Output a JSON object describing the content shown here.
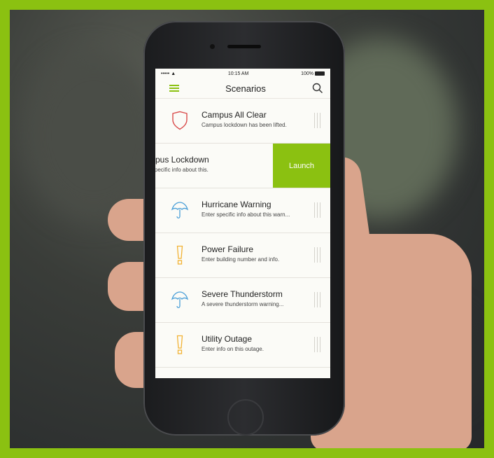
{
  "status_bar": {
    "signal": "••••• ▲",
    "time": "10:15 AM",
    "battery": "100%"
  },
  "navbar": {
    "title": "Scenarios",
    "menu_icon": "hamburger-menu-icon",
    "search_icon": "search-icon"
  },
  "scenarios": [
    {
      "title": "Campus All Clear",
      "subtitle": "Campus lockdown has been lifted.",
      "icon": "shield-icon",
      "icon_color": "#d94b4b"
    },
    {
      "title": "mpus Lockdown",
      "subtitle": "r specific info about this.",
      "swiped": true,
      "action_label": "Launch"
    },
    {
      "title": "Hurricane Warning",
      "subtitle": "Enter specific info about this warn...",
      "icon": "umbrella-icon",
      "icon_color": "#4a9fd8"
    },
    {
      "title": "Power Failure",
      "subtitle": "Enter building number and info.",
      "icon": "exclamation-icon",
      "icon_color": "#f2b233"
    },
    {
      "title": "Severe Thunderstorm",
      "subtitle": "A severe thunderstorm warning...",
      "icon": "umbrella-icon",
      "icon_color": "#4a9fd8"
    },
    {
      "title": "Utility Outage",
      "subtitle": "Enter info on this outage.",
      "icon": "exclamation-icon",
      "icon_color": "#f2b233"
    }
  ],
  "colors": {
    "accent": "#8bc111",
    "frame": "#8bc111"
  }
}
